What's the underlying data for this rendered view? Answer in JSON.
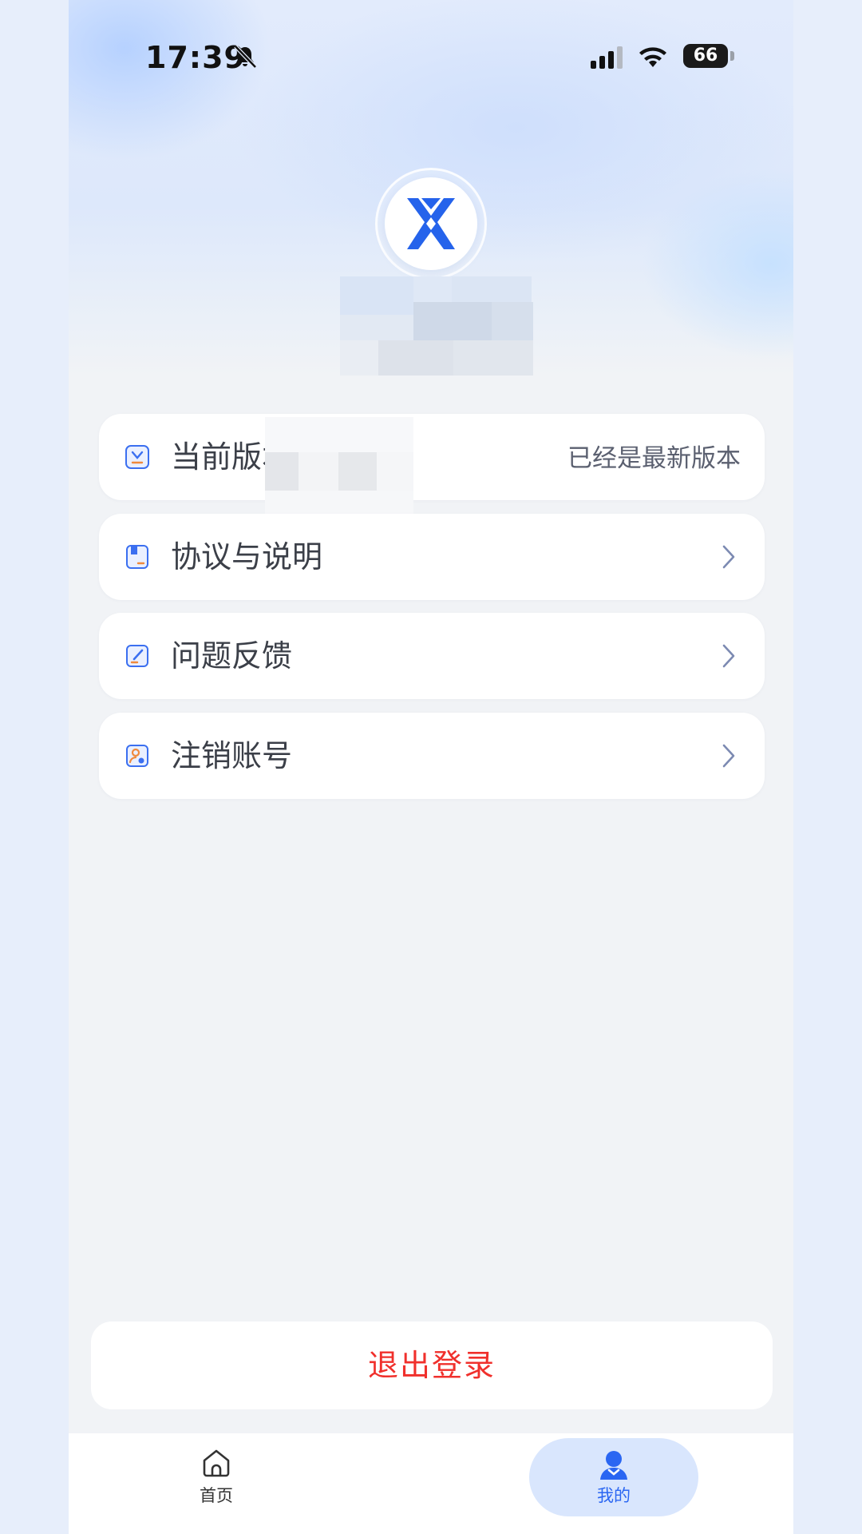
{
  "status_bar": {
    "time": "17:39",
    "battery": "66"
  },
  "menu": {
    "items": [
      {
        "label": "当前版本",
        "value": "已经是最新版本",
        "icon": "download-box-icon"
      },
      {
        "label": "协议与说明",
        "icon": "document-icon"
      },
      {
        "label": "问题反馈",
        "icon": "edit-note-icon"
      },
      {
        "label": "注销账号",
        "icon": "user-badge-icon"
      }
    ]
  },
  "logout": {
    "label": "退出登录"
  },
  "tabbar": {
    "tabs": [
      {
        "label": "首页",
        "icon": "home-icon"
      },
      {
        "label": "我的",
        "icon": "profile-icon",
        "active": true
      }
    ]
  },
  "colors": {
    "accent": "#2a66f2",
    "danger": "#f0302c",
    "background": "#f1f3f6"
  }
}
